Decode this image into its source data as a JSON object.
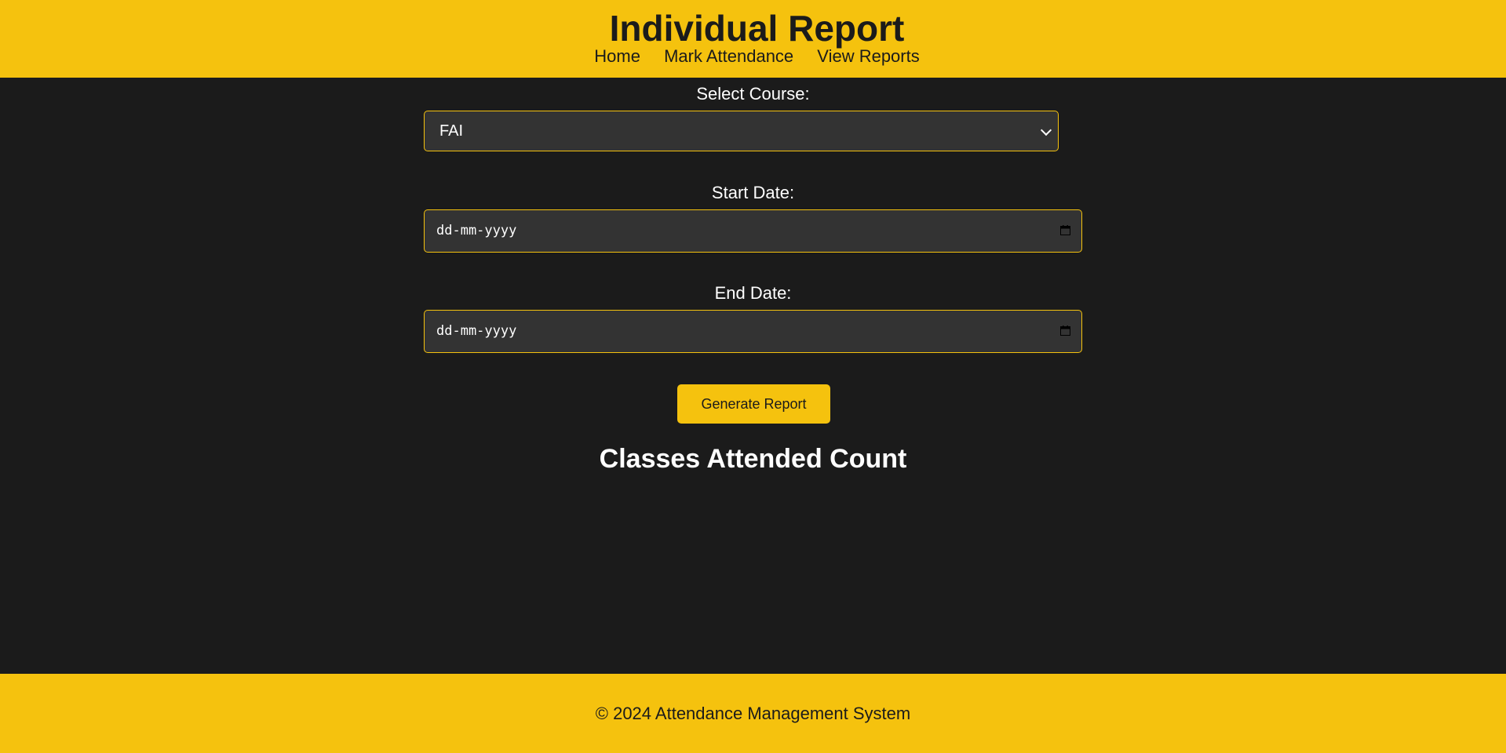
{
  "header": {
    "title": "Individual Report",
    "nav": [
      {
        "label": "Home"
      },
      {
        "label": "Mark Attendance"
      },
      {
        "label": "View Reports"
      }
    ]
  },
  "form": {
    "course": {
      "label": "Select Course:",
      "selected": "FAI"
    },
    "start_date": {
      "label": "Start Date:",
      "placeholder": "dd-mm-yyyy"
    },
    "end_date": {
      "label": "End Date:",
      "placeholder": "dd-mm-yyyy"
    },
    "submit_label": "Generate Report"
  },
  "results": {
    "heading": "Classes Attended Count"
  },
  "footer": {
    "text": "© 2024 Attendance Management System"
  },
  "colors": {
    "accent": "#f5c20e",
    "background": "#1b1b1b",
    "input_bg": "#333333"
  },
  "icons": {
    "select_chevron": "chevron-down-icon",
    "date_picker": "calendar-icon"
  }
}
